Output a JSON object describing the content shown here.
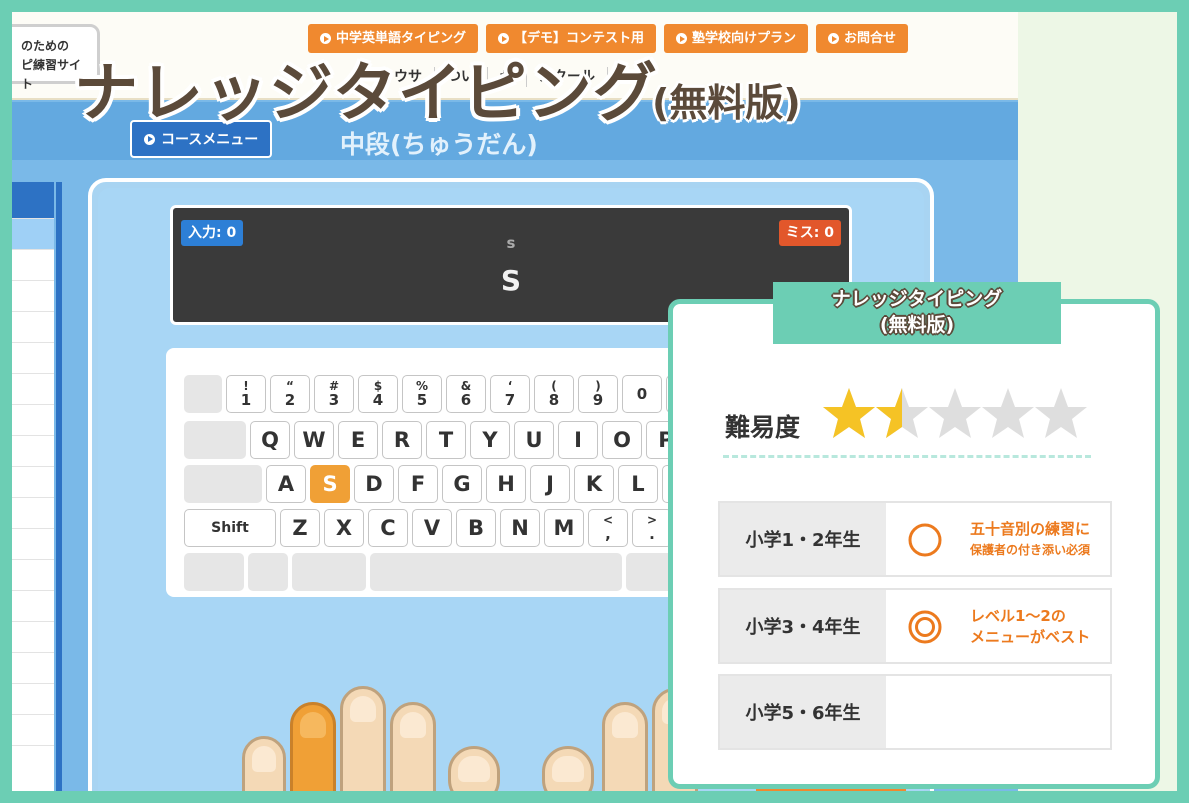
{
  "header": {
    "logo_line1": "のための",
    "logo_line2": "ピ練習サイト",
    "nav": [
      {
        "label": "中学英単語タイピング"
      },
      {
        "label": "【デモ】コンテスト用"
      },
      {
        "label": "塾学校向けプラン"
      },
      {
        "label": "お問合せ"
      }
    ],
    "subnav": [
      "ウサ",
      "つい",
      "せ",
      "スクール"
    ]
  },
  "hero": {
    "title": "ナレッジタイピング",
    "subtitle": "(無料版)"
  },
  "course": {
    "menu_button": "コースメニュー",
    "title": "中段(ちゅうだん)"
  },
  "display": {
    "input_badge": "入力: 0",
    "miss_badge": "ミス: 0",
    "kana": "s",
    "romaji": "S"
  },
  "keyboard": {
    "number_row": [
      {
        "top": "!",
        "bottom": "1"
      },
      {
        "top": "“",
        "bottom": "2"
      },
      {
        "top": "#",
        "bottom": "3"
      },
      {
        "top": "$",
        "bottom": "4"
      },
      {
        "top": "%",
        "bottom": "5"
      },
      {
        "top": "&",
        "bottom": "6"
      },
      {
        "top": "‘",
        "bottom": "7"
      },
      {
        "top": "(",
        "bottom": "8"
      },
      {
        "top": ")",
        "bottom": "9"
      },
      {
        "top": "",
        "bottom": "0"
      }
    ],
    "row_q": [
      "Q",
      "W",
      "E",
      "R",
      "T",
      "Y",
      "U",
      "I",
      "O",
      "P"
    ],
    "row_a": [
      "A",
      "S",
      "D",
      "F",
      "G",
      "H",
      "J",
      "K",
      "L"
    ],
    "row_z": [
      "Z",
      "X",
      "C",
      "V",
      "B",
      "N",
      "M"
    ],
    "comma_top": "<",
    "comma_bottom": ",",
    "period_top": ">",
    "period_bottom": ".",
    "shift_label": "Shift",
    "highlighted_key": "S"
  },
  "card": {
    "title_line1": "ナレッジタイピング",
    "title_line2": "(無料版)",
    "difficulty_label": "難易度",
    "difficulty_stars": 1.5,
    "difficulty_max": 5,
    "rows": [
      {
        "grade": "小学1・2年生",
        "mark": "circle",
        "text_line1": "五十音別の練習に",
        "text_line2": "保護者の付き添い必須"
      },
      {
        "grade": "小学3・4年生",
        "mark": "double-circle",
        "text_line1": "レベル1〜2の",
        "text_line2": "メニューがベスト"
      },
      {
        "grade": "小学5・6年生",
        "mark": "none",
        "text_line1": "",
        "text_line2": ""
      }
    ],
    "colors": {
      "accent": "#6cceb4",
      "orange": "#ec7a1e",
      "star_on": "#f5c325",
      "star_off": "#dedede"
    }
  }
}
